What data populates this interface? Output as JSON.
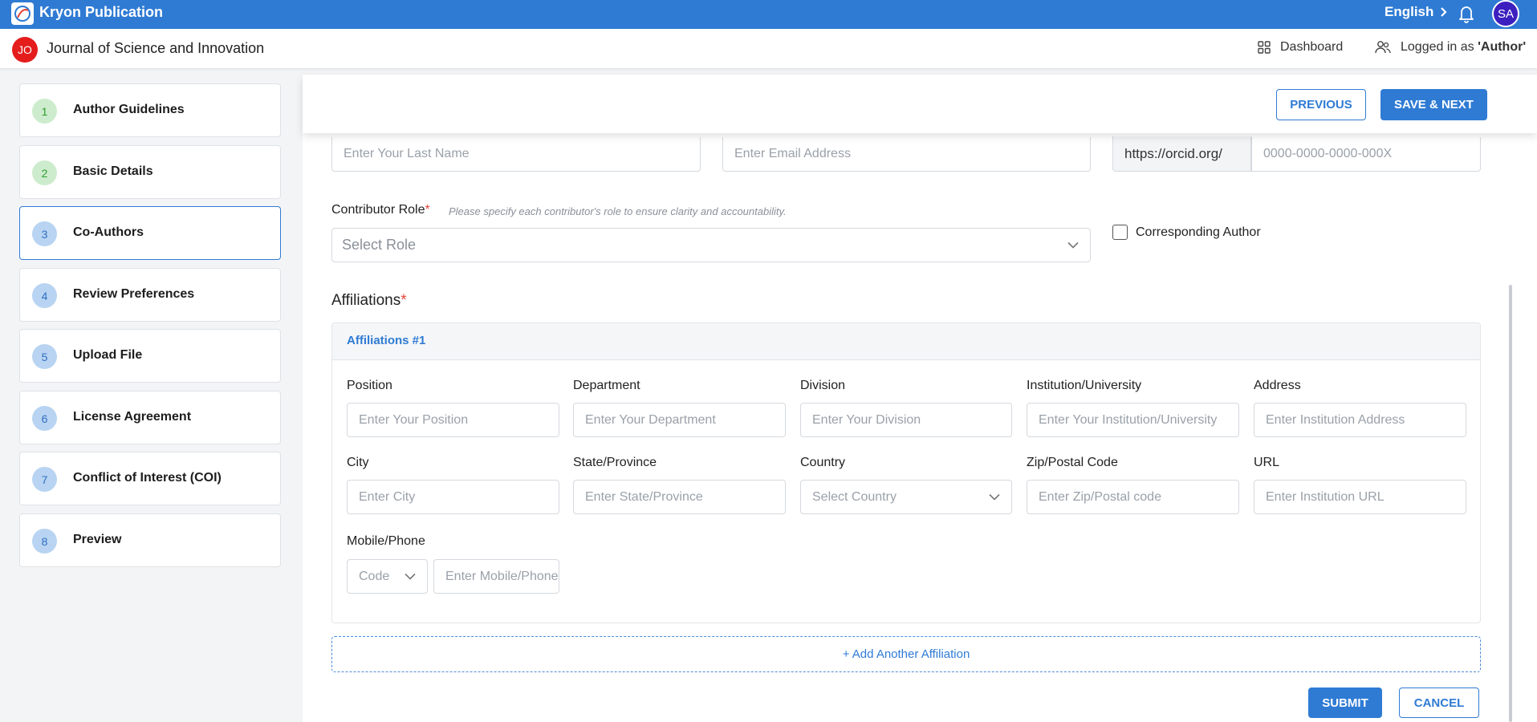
{
  "app": {
    "title": "Kryon Publication",
    "language": "English",
    "user_initials": "SA"
  },
  "journal": {
    "badge": "JO",
    "title": "Journal of Science and Innovation",
    "dashboard_label": "Dashboard",
    "logged_prefix": "Logged in as ",
    "logged_role": "'Author'"
  },
  "steps": [
    {
      "num": "1",
      "label": "Author Guidelines",
      "state": "done"
    },
    {
      "num": "2",
      "label": "Basic Details",
      "state": "done"
    },
    {
      "num": "3",
      "label": "Co-Authors",
      "state": "active"
    },
    {
      "num": "4",
      "label": "Review Preferences",
      "state": "todo"
    },
    {
      "num": "5",
      "label": "Upload File",
      "state": "todo"
    },
    {
      "num": "6",
      "label": "License Agreement",
      "state": "todo"
    },
    {
      "num": "7",
      "label": "Conflict of Interest (COI)",
      "state": "todo"
    },
    {
      "num": "8",
      "label": "Preview",
      "state": "todo"
    }
  ],
  "actions": {
    "previous": "PREVIOUS",
    "save_next": "SAVE & NEXT",
    "submit": "SUBMIT",
    "cancel": "CANCEL"
  },
  "coauthor": {
    "last_name_placeholder": "Enter Your Last Name",
    "email_placeholder": "Enter Email Address",
    "orcid_prefix": "https://orcid.org/",
    "orcid_placeholder": "0000-0000-0000-000X",
    "contributor_role_label": "Contributor Role",
    "required_mark": "*",
    "contributor_role_help": "Please specify each contributor's role to ensure clarity and accountability.",
    "role_placeholder": "Select Role",
    "corresponding_label": "Corresponding Author"
  },
  "affiliations": {
    "title": "Affiliations",
    "card_title": "Affiliations #1",
    "labels": {
      "position": "Position",
      "department": "Department",
      "division": "Division",
      "institution": "Institution/University",
      "address": "Address",
      "city": "City",
      "state": "State/Province",
      "country": "Country",
      "zip": "Zip/Postal Code",
      "url": "URL",
      "phone": "Mobile/Phone"
    },
    "placeholders": {
      "position": "Enter Your Position",
      "department": "Enter Your Department",
      "division": "Enter Your Division",
      "institution": "Enter Your Institution/University",
      "address": "Enter Institution Address",
      "city": "Enter City",
      "state": "Enter State/Province",
      "country": "Select Country",
      "zip": "Enter Zip/Postal code",
      "url": "Enter Institution URL",
      "code": "Code",
      "phone": "Enter Mobile/Phone"
    },
    "add_another": "+ Add Another Affiliation"
  },
  "colors": {
    "primary": "#2f7bd4",
    "badge_red": "#e41c1c",
    "avatar": "#3c1fbf",
    "step_done_bg": "#cdeccd",
    "step_todo_bg": "#b8d4f2"
  },
  "icons": [
    "kryon-logo-icon",
    "chevron-right-icon",
    "bell-icon",
    "dashboard-grid-icon",
    "users-icon",
    "chevron-down-icon"
  ]
}
